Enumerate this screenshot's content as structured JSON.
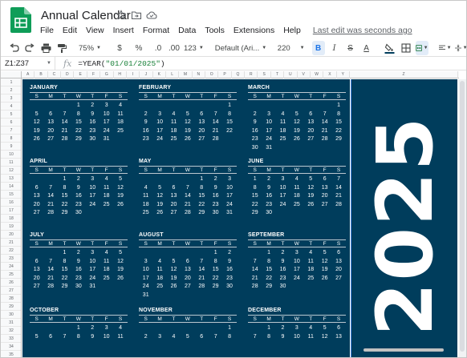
{
  "app": {
    "title": "Annual Calendar",
    "menu": [
      "File",
      "Edit",
      "View",
      "Insert",
      "Format",
      "Data",
      "Tools",
      "Extensions",
      "Help"
    ],
    "last_edit": "Last edit was seconds ago"
  },
  "toolbar": {
    "zoom": "75%",
    "currency": "$",
    "percent": "%",
    "decrease_decimals": ".0",
    "increase_decimals": ".00",
    "more_formats": "123",
    "font": "Default (Ari...",
    "font_size": "220",
    "bold": "B",
    "italic": "I",
    "strikethrough": "S",
    "text_color": "A"
  },
  "formula_bar": {
    "name_box": "Z1:Z37",
    "fx": "fx",
    "formula_prefix": "=YEAR(",
    "formula_string": "\"01/01/2025\"",
    "formula_suffix": ")"
  },
  "columns": [
    "A",
    "B",
    "C",
    "D",
    "E",
    "F",
    "G",
    "H",
    "I",
    "J",
    "K",
    "L",
    "M",
    "N",
    "O",
    "P",
    "Q",
    "R",
    "S",
    "T",
    "U",
    "V",
    "W",
    "X",
    "Y",
    "Z"
  ],
  "rows": [
    "1",
    "2",
    "3",
    "4",
    "5",
    "6",
    "7",
    "8",
    "9",
    "10",
    "11",
    "12",
    "13",
    "14",
    "15",
    "16",
    "17",
    "18",
    "19",
    "20",
    "21",
    "22",
    "23",
    "24",
    "25",
    "26",
    "27",
    "28",
    "29",
    "30",
    "31",
    "32",
    "33",
    "34",
    "35"
  ],
  "calendar": {
    "year": "2025",
    "dow": [
      "S",
      "M",
      "T",
      "W",
      "T",
      "F",
      "S"
    ],
    "months": [
      {
        "name": "JANUARY",
        "weeks": [
          [
            "",
            "",
            "",
            "1",
            "2",
            "3",
            "4"
          ],
          [
            "5",
            "6",
            "7",
            "8",
            "9",
            "10",
            "11"
          ],
          [
            "12",
            "13",
            "14",
            "15",
            "16",
            "17",
            "18"
          ],
          [
            "19",
            "20",
            "21",
            "22",
            "23",
            "24",
            "25"
          ],
          [
            "26",
            "27",
            "28",
            "29",
            "30",
            "31",
            ""
          ]
        ]
      },
      {
        "name": "FEBRUARY",
        "weeks": [
          [
            "",
            "",
            "",
            "",
            "",
            "",
            "1"
          ],
          [
            "2",
            "3",
            "4",
            "5",
            "6",
            "7",
            "8"
          ],
          [
            "9",
            "10",
            "11",
            "12",
            "13",
            "14",
            "15"
          ],
          [
            "16",
            "17",
            "18",
            "19",
            "20",
            "21",
            "22"
          ],
          [
            "23",
            "24",
            "25",
            "26",
            "27",
            "28",
            ""
          ]
        ]
      },
      {
        "name": "MARCH",
        "weeks": [
          [
            "",
            "",
            "",
            "",
            "",
            "",
            "1"
          ],
          [
            "2",
            "3",
            "4",
            "5",
            "6",
            "7",
            "8"
          ],
          [
            "9",
            "10",
            "11",
            "12",
            "13",
            "14",
            "15"
          ],
          [
            "16",
            "17",
            "18",
            "19",
            "20",
            "21",
            "22"
          ],
          [
            "23",
            "24",
            "25",
            "26",
            "27",
            "28",
            "29"
          ],
          [
            "30",
            "31",
            "",
            "",
            "",
            "",
            ""
          ]
        ]
      },
      {
        "name": "APRIL",
        "weeks": [
          [
            "",
            "",
            "1",
            "2",
            "3",
            "4",
            "5"
          ],
          [
            "6",
            "7",
            "8",
            "9",
            "10",
            "11",
            "12"
          ],
          [
            "13",
            "14",
            "15",
            "16",
            "17",
            "18",
            "19"
          ],
          [
            "20",
            "21",
            "22",
            "23",
            "24",
            "25",
            "26"
          ],
          [
            "27",
            "28",
            "29",
            "30",
            "",
            "",
            ""
          ]
        ]
      },
      {
        "name": "MAY",
        "weeks": [
          [
            "",
            "",
            "",
            "",
            "1",
            "2",
            "3"
          ],
          [
            "4",
            "5",
            "6",
            "7",
            "8",
            "9",
            "10"
          ],
          [
            "11",
            "12",
            "13",
            "14",
            "15",
            "16",
            "17"
          ],
          [
            "18",
            "19",
            "20",
            "21",
            "22",
            "23",
            "24"
          ],
          [
            "25",
            "26",
            "27",
            "28",
            "29",
            "30",
            "31"
          ]
        ]
      },
      {
        "name": "JUNE",
        "weeks": [
          [
            "1",
            "2",
            "3",
            "4",
            "5",
            "6",
            "7"
          ],
          [
            "8",
            "9",
            "10",
            "11",
            "12",
            "13",
            "14"
          ],
          [
            "15",
            "16",
            "17",
            "18",
            "19",
            "20",
            "21"
          ],
          [
            "22",
            "23",
            "24",
            "25",
            "26",
            "27",
            "28"
          ],
          [
            "29",
            "30",
            "",
            "",
            "",
            "",
            ""
          ]
        ]
      },
      {
        "name": "JULY",
        "weeks": [
          [
            "",
            "",
            "1",
            "2",
            "3",
            "4",
            "5"
          ],
          [
            "6",
            "7",
            "8",
            "9",
            "10",
            "11",
            "12"
          ],
          [
            "13",
            "14",
            "15",
            "16",
            "17",
            "18",
            "19"
          ],
          [
            "20",
            "21",
            "22",
            "23",
            "24",
            "25",
            "26"
          ],
          [
            "27",
            "28",
            "29",
            "30",
            "31",
            "",
            ""
          ]
        ]
      },
      {
        "name": "AUGUST",
        "weeks": [
          [
            "",
            "",
            "",
            "",
            "",
            "1",
            "2"
          ],
          [
            "3",
            "4",
            "5",
            "6",
            "7",
            "8",
            "9"
          ],
          [
            "10",
            "11",
            "12",
            "13",
            "14",
            "15",
            "16"
          ],
          [
            "17",
            "18",
            "19",
            "20",
            "21",
            "22",
            "23"
          ],
          [
            "24",
            "25",
            "26",
            "27",
            "28",
            "29",
            "30"
          ],
          [
            "31",
            "",
            "",
            "",
            "",
            "",
            ""
          ]
        ]
      },
      {
        "name": "SEPTEMBER",
        "weeks": [
          [
            "",
            "1",
            "2",
            "3",
            "4",
            "5",
            "6"
          ],
          [
            "7",
            "8",
            "9",
            "10",
            "11",
            "12",
            "13"
          ],
          [
            "14",
            "15",
            "16",
            "17",
            "18",
            "19",
            "20"
          ],
          [
            "21",
            "22",
            "23",
            "24",
            "25",
            "26",
            "27"
          ],
          [
            "28",
            "29",
            "30",
            "",
            "",
            "",
            ""
          ]
        ]
      },
      {
        "name": "OCTOBER",
        "weeks": [
          [
            "",
            "",
            "",
            "1",
            "2",
            "3",
            "4"
          ],
          [
            "5",
            "6",
            "7",
            "8",
            "9",
            "10",
            "11"
          ]
        ]
      },
      {
        "name": "NOVEMBER",
        "weeks": [
          [
            "",
            "",
            "",
            "",
            "",
            "",
            "1"
          ],
          [
            "2",
            "3",
            "4",
            "5",
            "6",
            "7",
            "8"
          ]
        ]
      },
      {
        "name": "DECEMBER",
        "weeks": [
          [
            "",
            "1",
            "2",
            "3",
            "4",
            "5",
            "6"
          ],
          [
            "7",
            "8",
            "9",
            "10",
            "11",
            "12",
            "13"
          ]
        ]
      }
    ]
  },
  "colors": {
    "calendar_bg": "#003d5c",
    "sheets_green": "#0f9d58",
    "accent_blue": "#1a73e8"
  }
}
